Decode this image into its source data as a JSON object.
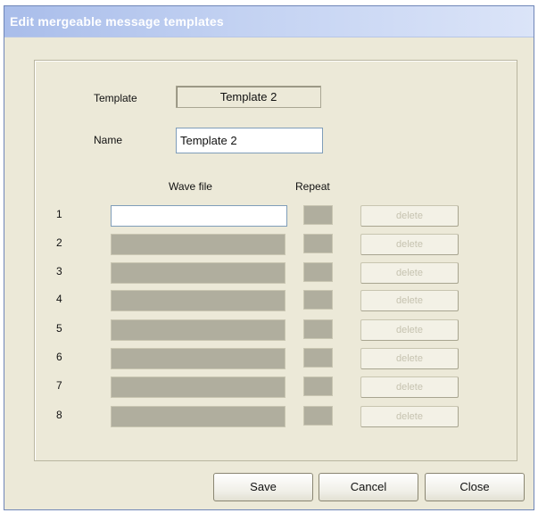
{
  "window": {
    "title": "Edit mergeable message templates"
  },
  "form": {
    "template_label": "Template",
    "template_value": "Template 2",
    "name_label": "Name",
    "name_value": "Template 2"
  },
  "table": {
    "headers": {
      "wave_file": "Wave file",
      "repeat": "Repeat"
    },
    "rows": [
      {
        "num": "1",
        "wave_file": "",
        "repeat": "",
        "delete_label": "delete"
      },
      {
        "num": "2",
        "wave_file": "",
        "repeat": "",
        "delete_label": "delete"
      },
      {
        "num": "3",
        "wave_file": "",
        "repeat": "",
        "delete_label": "delete"
      },
      {
        "num": "4",
        "wave_file": "",
        "repeat": "",
        "delete_label": "delete"
      },
      {
        "num": "5",
        "wave_file": "",
        "repeat": "",
        "delete_label": "delete"
      },
      {
        "num": "6",
        "wave_file": "",
        "repeat": "",
        "delete_label": "delete"
      },
      {
        "num": "7",
        "wave_file": "",
        "repeat": "",
        "delete_label": "delete"
      },
      {
        "num": "8",
        "wave_file": "",
        "repeat": "",
        "delete_label": "delete"
      }
    ]
  },
  "buttons": {
    "save": "Save",
    "cancel": "Cancel",
    "close": "Close"
  }
}
